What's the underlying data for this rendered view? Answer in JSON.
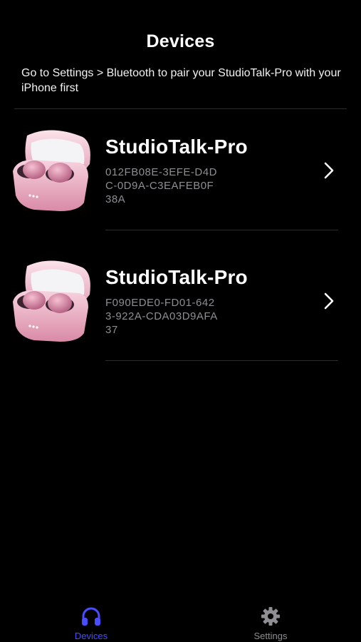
{
  "header": {
    "title": "Devices",
    "hint": "Go to Settings > Bluetooth to pair your StudioTalk-Pro with your iPhone first"
  },
  "devices": [
    {
      "name": "StudioTalk-Pro",
      "id": "012FB08E-3EFE-D4DC-0D9A-C3EAFEB0F38A",
      "icon": "earbuds-case-image"
    },
    {
      "name": "StudioTalk-Pro",
      "id": "F090EDE0-FD01-6423-922A-CDA03D9AFA37",
      "icon": "earbuds-case-image"
    }
  ],
  "tabbar": {
    "devices_label": "Devices",
    "settings_label": "Settings",
    "devices_icon": "headphones-icon",
    "settings_icon": "gear-icon",
    "active_color": "#4a4dff",
    "inactive_color": "#8e8e93"
  }
}
